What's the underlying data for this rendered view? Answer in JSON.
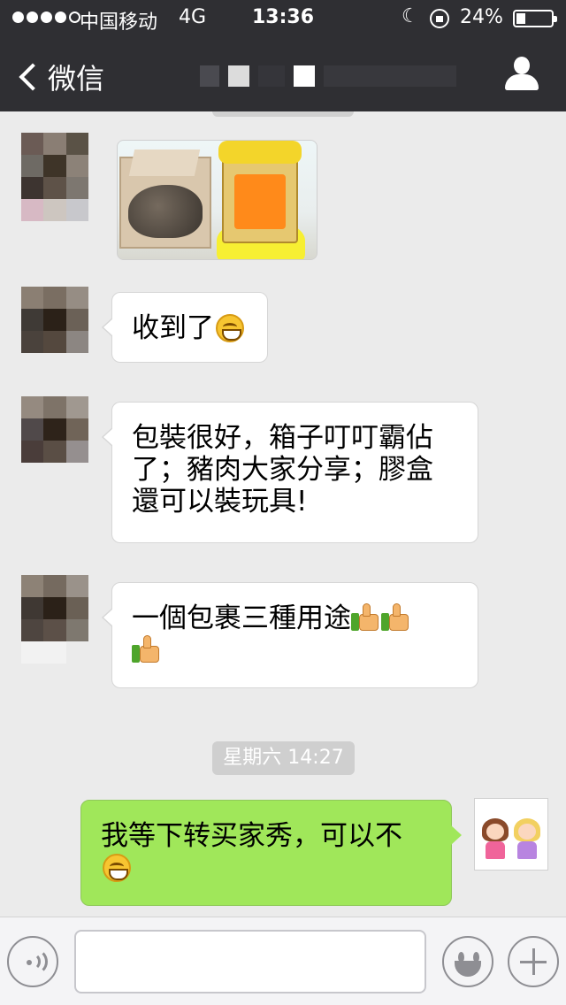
{
  "status_bar": {
    "signal_bars": 4,
    "signal_max": 5,
    "carrier": "中国移动",
    "network": "4G",
    "time": "13:36",
    "battery": "24%"
  },
  "nav": {
    "back_label": "微信"
  },
  "messages": [
    {
      "id": 1,
      "side": "left",
      "type": "image"
    },
    {
      "id": 2,
      "side": "left",
      "type": "text",
      "text": "收到了",
      "emoji": "grin-icon"
    },
    {
      "id": 3,
      "side": "left",
      "type": "text",
      "lines": [
        "包裝很好，箱子叮叮霸佔",
        "了；豬肉大家分享；膠盒",
        "還可以裝玩具!"
      ]
    },
    {
      "id": 4,
      "side": "left",
      "type": "text",
      "text": "一個包裹三種用途",
      "emoji": "thumbs-up-icon"
    },
    {
      "id": 5,
      "side": "right",
      "type": "text",
      "text": "我等下转买家秀，可以不",
      "emoji": "grin-icon"
    }
  ],
  "timestamp": "星期六 14:27",
  "colors": {
    "nav_bg": "#2f2f33",
    "chat_bg": "#ebebeb",
    "incoming_bubble": "#ffffff",
    "outgoing_bubble": "#a0e75a"
  },
  "input_bar": {
    "text_value": ""
  }
}
